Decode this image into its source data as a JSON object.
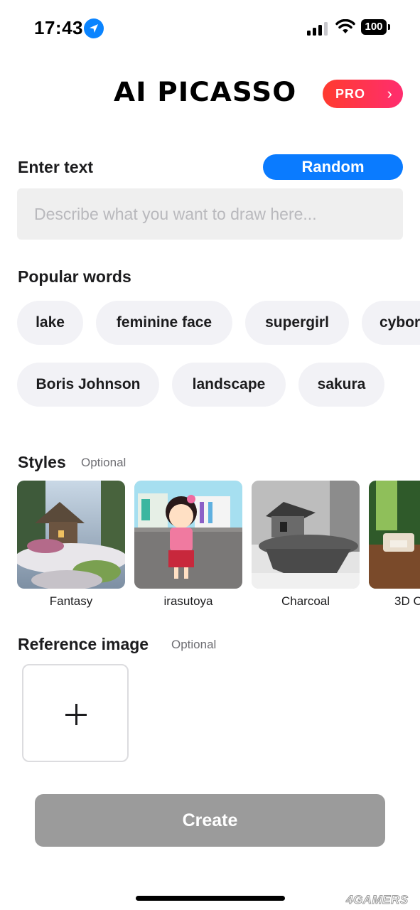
{
  "status_bar": {
    "time": "17:43",
    "battery": "100",
    "icons": [
      "location-arrow-icon",
      "cellular-signal-icon",
      "wifi-icon",
      "battery-icon"
    ]
  },
  "header": {
    "title": "AI PICASSO",
    "pro_label": "PRO",
    "pro_chevron": "›",
    "pro_gradient": [
      "#ff3b2f",
      "#ff2d6f"
    ]
  },
  "enter_text": {
    "label": "Enter text",
    "random_label": "Random",
    "input_value": "",
    "placeholder": "Describe what you want to draw here..."
  },
  "popular_words": {
    "label": "Popular words",
    "rows": [
      [
        "lake",
        "feminine face",
        "supergirl",
        "cybor"
      ],
      [
        "Boris Johnson",
        "landscape",
        "sakura"
      ]
    ]
  },
  "styles": {
    "label": "Styles",
    "optional": "Optional",
    "items": [
      {
        "name": "Fantasy"
      },
      {
        "name": "irasutoya"
      },
      {
        "name": "Charcoal"
      },
      {
        "name": "3D C"
      }
    ]
  },
  "reference_image": {
    "label": "Reference image",
    "optional": "Optional",
    "add_icon": "plus-icon"
  },
  "create_label": "Create",
  "watermark": "4GAMERS",
  "colors": {
    "accent": "#0a7bff",
    "chip_bg": "#f2f2f6",
    "input_bg": "#efefef",
    "create_disabled": "#9b9b9b"
  }
}
